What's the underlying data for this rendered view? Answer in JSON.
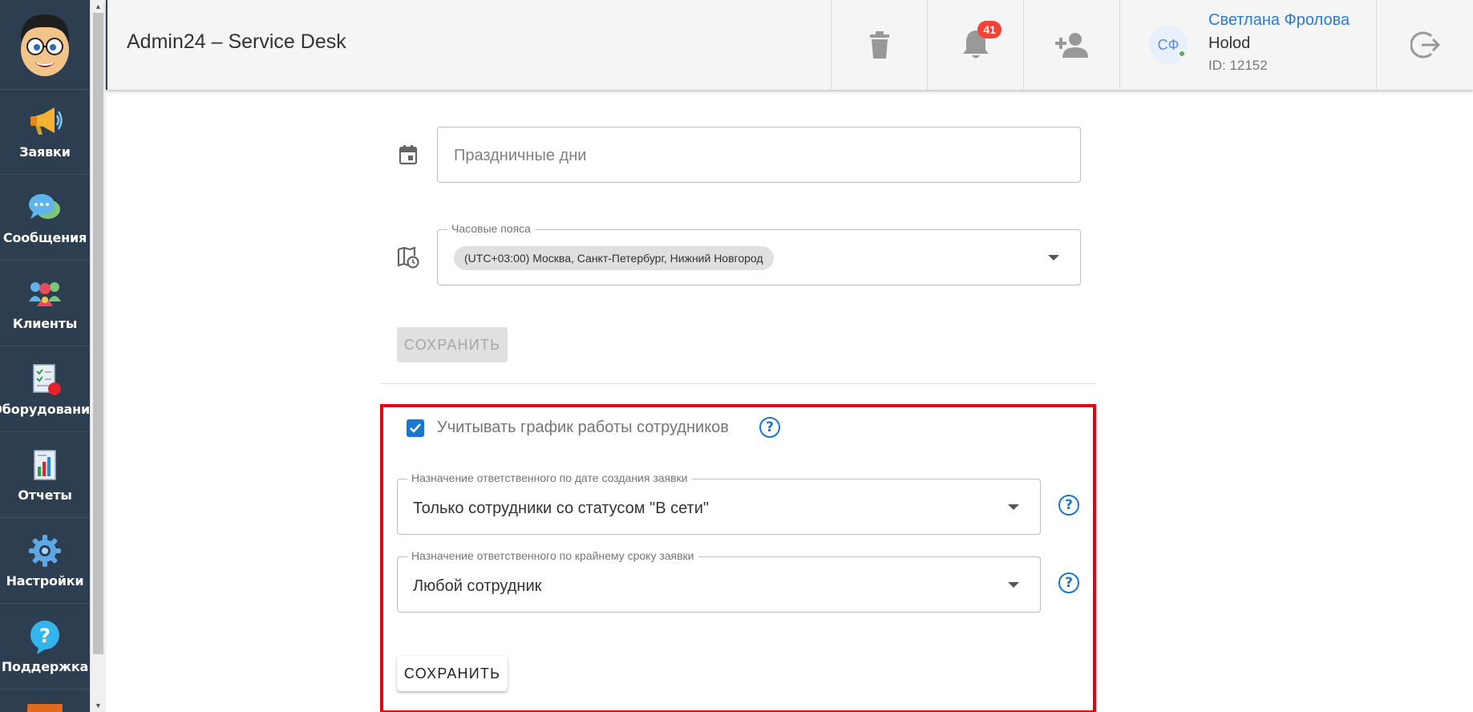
{
  "header": {
    "app_title": "Admin24 – Service Desk",
    "notification_count": "41",
    "user": {
      "initials": "СФ",
      "name": "Светлана Фролова",
      "org": "Holod",
      "id": "ID: 12152"
    }
  },
  "sidebar": {
    "items": [
      {
        "label": "Заявки",
        "icon": "megaphone-icon"
      },
      {
        "label": "Сообщения",
        "icon": "chat-bubbles-icon"
      },
      {
        "label": "Клиенты",
        "icon": "clients-icon"
      },
      {
        "label": "Оборудование",
        "icon": "equipment-icon"
      },
      {
        "label": "Отчеты",
        "icon": "report-icon"
      },
      {
        "label": "Настройки",
        "icon": "gear-icon"
      },
      {
        "label": "Поддержка",
        "icon": "question-icon"
      }
    ]
  },
  "form": {
    "holidays_placeholder": "Праздничные дни",
    "timezone_label": "Часовые пояса",
    "timezone_value": "(UTC+03:00) Москва, Санкт-Петербург, Нижний Новгород",
    "save_disabled_label": "СОХРАНИТЬ",
    "schedule_checkbox_label": "Учитывать график работы сотрудников",
    "schedule_checked": true,
    "assign_by_creation_label": "Назначение ответственного по дате создания заявки",
    "assign_by_creation_value": "Только сотрудники со статусом \"В сети\"",
    "assign_by_deadline_label": "Назначение ответственного по крайнему сроку заявки",
    "assign_by_deadline_value": "Любой сотрудник",
    "save_label": "СОХРАНИТЬ"
  },
  "colors": {
    "sidebar_bg": "#2c3e50",
    "accent": "#1976d2",
    "highlight": "#e8000f",
    "badge": "#f44336"
  }
}
